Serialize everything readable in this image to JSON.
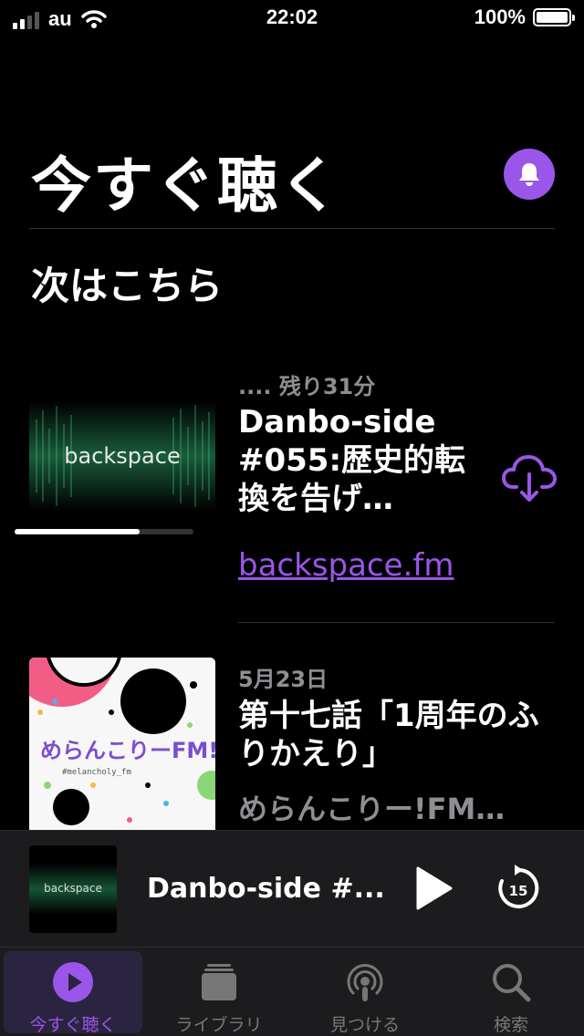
{
  "status": {
    "carrier": "au",
    "time": "22:02",
    "battery": "100%"
  },
  "header": {
    "title": "今すぐ聴く"
  },
  "section": {
    "title": "次はこちら"
  },
  "episodes": [
    {
      "artwork_text": "backspace",
      "meta": ".... 残り31分",
      "title": "Danbo-side #055:歴史的転換を告げ…",
      "link": "backspace.fm",
      "progress": 0.7
    },
    {
      "meta": "5月23日",
      "title": "第十七話「1周年のふりかえり」",
      "show": "めらんこりー!FM…",
      "artwork_text": "めらんこりーFM!",
      "artwork_subtext": "#melancholy_fm"
    }
  ],
  "mini_player": {
    "artwork_text": "backspace",
    "title": "Danbo-side #..."
  },
  "tabs": [
    {
      "label": "今すぐ聴く",
      "icon": "play-circle-icon",
      "active": true
    },
    {
      "label": "ライブラリ",
      "icon": "library-stack-icon",
      "active": false
    },
    {
      "label": "見つける",
      "icon": "podcast-icon",
      "active": false
    },
    {
      "label": "検索",
      "icon": "search-icon",
      "active": false
    }
  ],
  "colors": {
    "accent": "#9a56e8",
    "background": "#000000",
    "secondary_text": "#8e8e93",
    "bar_background": "#1c1c1e"
  }
}
